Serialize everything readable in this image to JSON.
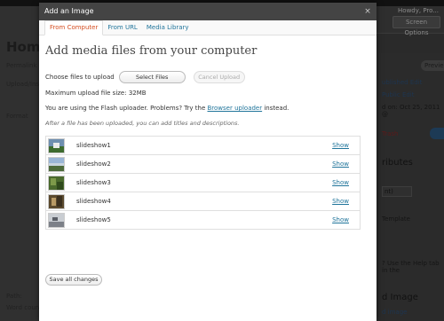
{
  "background": {
    "user_text": "Howdy, Pro...",
    "screen_options": "Screen Options",
    "page_title": "Home",
    "left_labels": [
      "Permalink",
      "Upload/Ins",
      "Format",
      "Path:",
      "Word count"
    ],
    "right_labels": [
      "ublished Edit",
      "Public Edit",
      "d on: Oct 25, 2011 @",
      "Trash",
      "ributes",
      "Template",
      "nt)",
      "? Use the Help tab in the",
      "d Image",
      "d image"
    ],
    "preview_label": "Previe",
    "tab_fragment": "Ed"
  },
  "modal": {
    "title": "Add an Image",
    "close_glyph": "×",
    "tabs": [
      {
        "label": "From Computer",
        "active": true
      },
      {
        "label": "From URL",
        "active": false
      },
      {
        "label": "Media Library",
        "active": false
      }
    ],
    "heading": "Add media files from your computer",
    "choose_label": "Choose files to upload",
    "select_button": "Select Files",
    "cancel_button": "Cancel Upload",
    "max_size_text": "Maximum upload file size: 32MB",
    "flash_prefix": "You are using the Flash uploader.  Problems?  Try the ",
    "flash_link": "Browser uploader",
    "flash_suffix": " instead.",
    "after_upload": "After a file has been uploaded, you can add titles and descriptions.",
    "files": [
      {
        "name": "slideshow1",
        "action": "Show"
      },
      {
        "name": "slideshow2",
        "action": "Show"
      },
      {
        "name": "slideshow3",
        "action": "Show"
      },
      {
        "name": "slideshow4",
        "action": "Show"
      },
      {
        "name": "slideshow5",
        "action": "Show"
      }
    ],
    "save_button": "Save all changes"
  },
  "colors": {
    "link": "#21759b",
    "active_tab": "#d54e21",
    "titlebar": "#444444"
  }
}
